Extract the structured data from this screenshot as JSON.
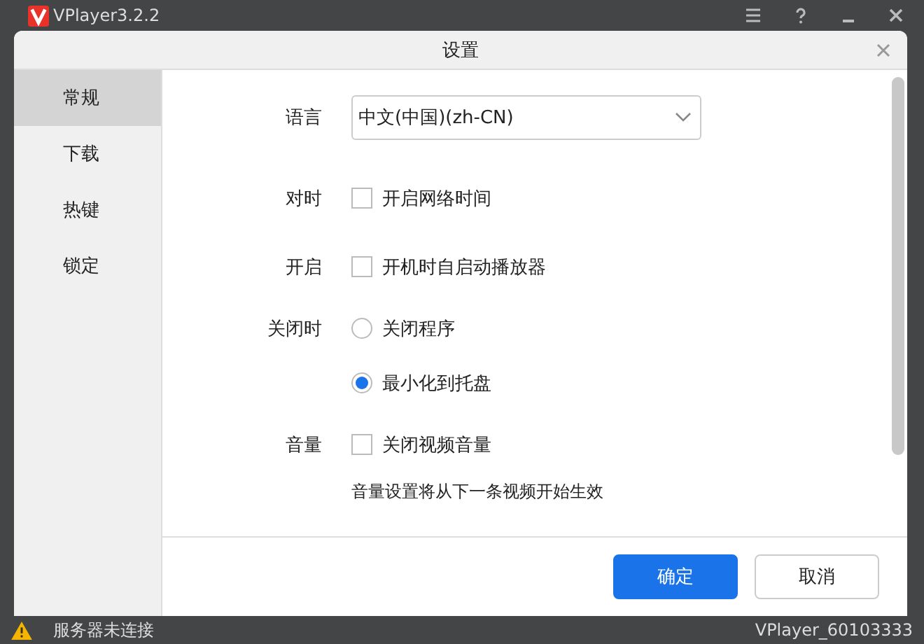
{
  "window": {
    "title": "VPlayer3.2.2"
  },
  "dialog": {
    "title": "设置"
  },
  "sidebar": {
    "items": [
      {
        "label": "常规",
        "selected": true
      },
      {
        "label": "下载",
        "selected": false
      },
      {
        "label": "热键",
        "selected": false
      },
      {
        "label": "锁定",
        "selected": false
      }
    ]
  },
  "settings": [
    {
      "kind": "select",
      "label": "语言",
      "value": "中文(中国)(zh-CN)"
    },
    {
      "kind": "checkbox",
      "label": "对时",
      "option": "开启网络时间",
      "checked": false
    },
    {
      "kind": "checkbox",
      "label": "开启",
      "option": "开机时自启动播放器",
      "checked": false
    },
    {
      "kind": "radio",
      "label": "关闭时",
      "options": [
        {
          "label": "关闭程序",
          "selected": false
        },
        {
          "label": "最小化到托盘",
          "selected": true
        }
      ]
    },
    {
      "kind": "checkbox",
      "label": "音量",
      "option": "关闭视频音量",
      "checked": false,
      "note": "音量设置将从下一条视频开始生效"
    }
  ],
  "buttons": [
    {
      "label": "确定",
      "kind": "primary"
    },
    {
      "label": "取消",
      "kind": "secondary"
    }
  ],
  "status_bar": {
    "message": "服务器未连接",
    "version": "VPlayer_60103333"
  }
}
